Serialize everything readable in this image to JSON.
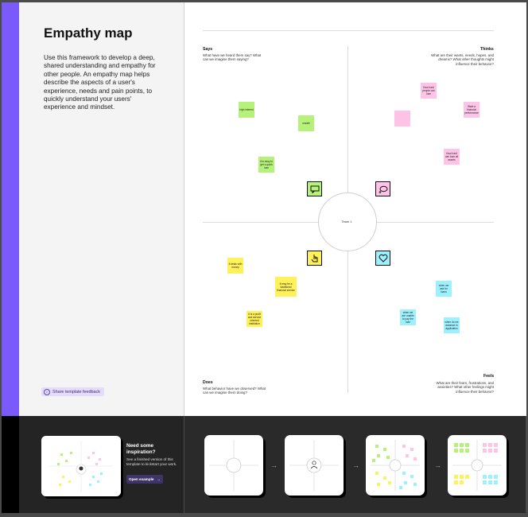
{
  "template": {
    "title": "Empathy map",
    "description": "Use this framework to develop a deep, shared understanding and empathy for other people. An empathy map helps describe the aspects of a user's experience, needs and pain points, to quickly understand your users' experience and mindset.",
    "feedback_label": "Share template feedback"
  },
  "inspiration": {
    "title": "Need some inspiration?",
    "text": "See a finished version of this template to kickstart your work.",
    "button_label": "Open example",
    "button_arrow": "→"
  },
  "map": {
    "center_label": "Team 1",
    "says": {
      "title": "Says",
      "question": "What have we heard them say? What can we imagine them saying?"
    },
    "thinks": {
      "title": "Thinks",
      "question": "What are their wants, needs, hopes, and dreams? What other thoughts might influence their behavior?"
    },
    "does": {
      "title": "Does",
      "question": "What behavior have we observed? What can we imagine them doing?"
    },
    "feels": {
      "title": "Feels",
      "question": "What are their fears, frustrations, and anxieties? What other feelings might influence their behavior?"
    },
    "stickies": {
      "s1": "high interest",
      "s2": "unsafe",
      "s3": "It is easy to get a quick loan",
      "t1": "How hard people can loan",
      "t2": "",
      "t3": "Want a financial performance",
      "t4": "How hard can loan all assets",
      "d1": "It deals with money",
      "d2": "It may be a traditional financial service",
      "d3": "It is a profit and service oriented institution",
      "f1": "when we ask for loans",
      "f2": "when we are unable to pay the loan",
      "f3": "when do we advance in application"
    }
  },
  "colors": {
    "accent": "#7a5af8",
    "green": "#b6f27a",
    "yellow": "#fff159",
    "pink": "#ffc3e8",
    "cyan": "#9df1ff"
  },
  "icons": {
    "says": "speech-bubble-icon",
    "thinks": "thought-bubble-icon",
    "does": "hand-pointer-icon",
    "feels": "heart-icon",
    "arrow": "arrow-right-icon"
  },
  "steps_arrow": "→"
}
